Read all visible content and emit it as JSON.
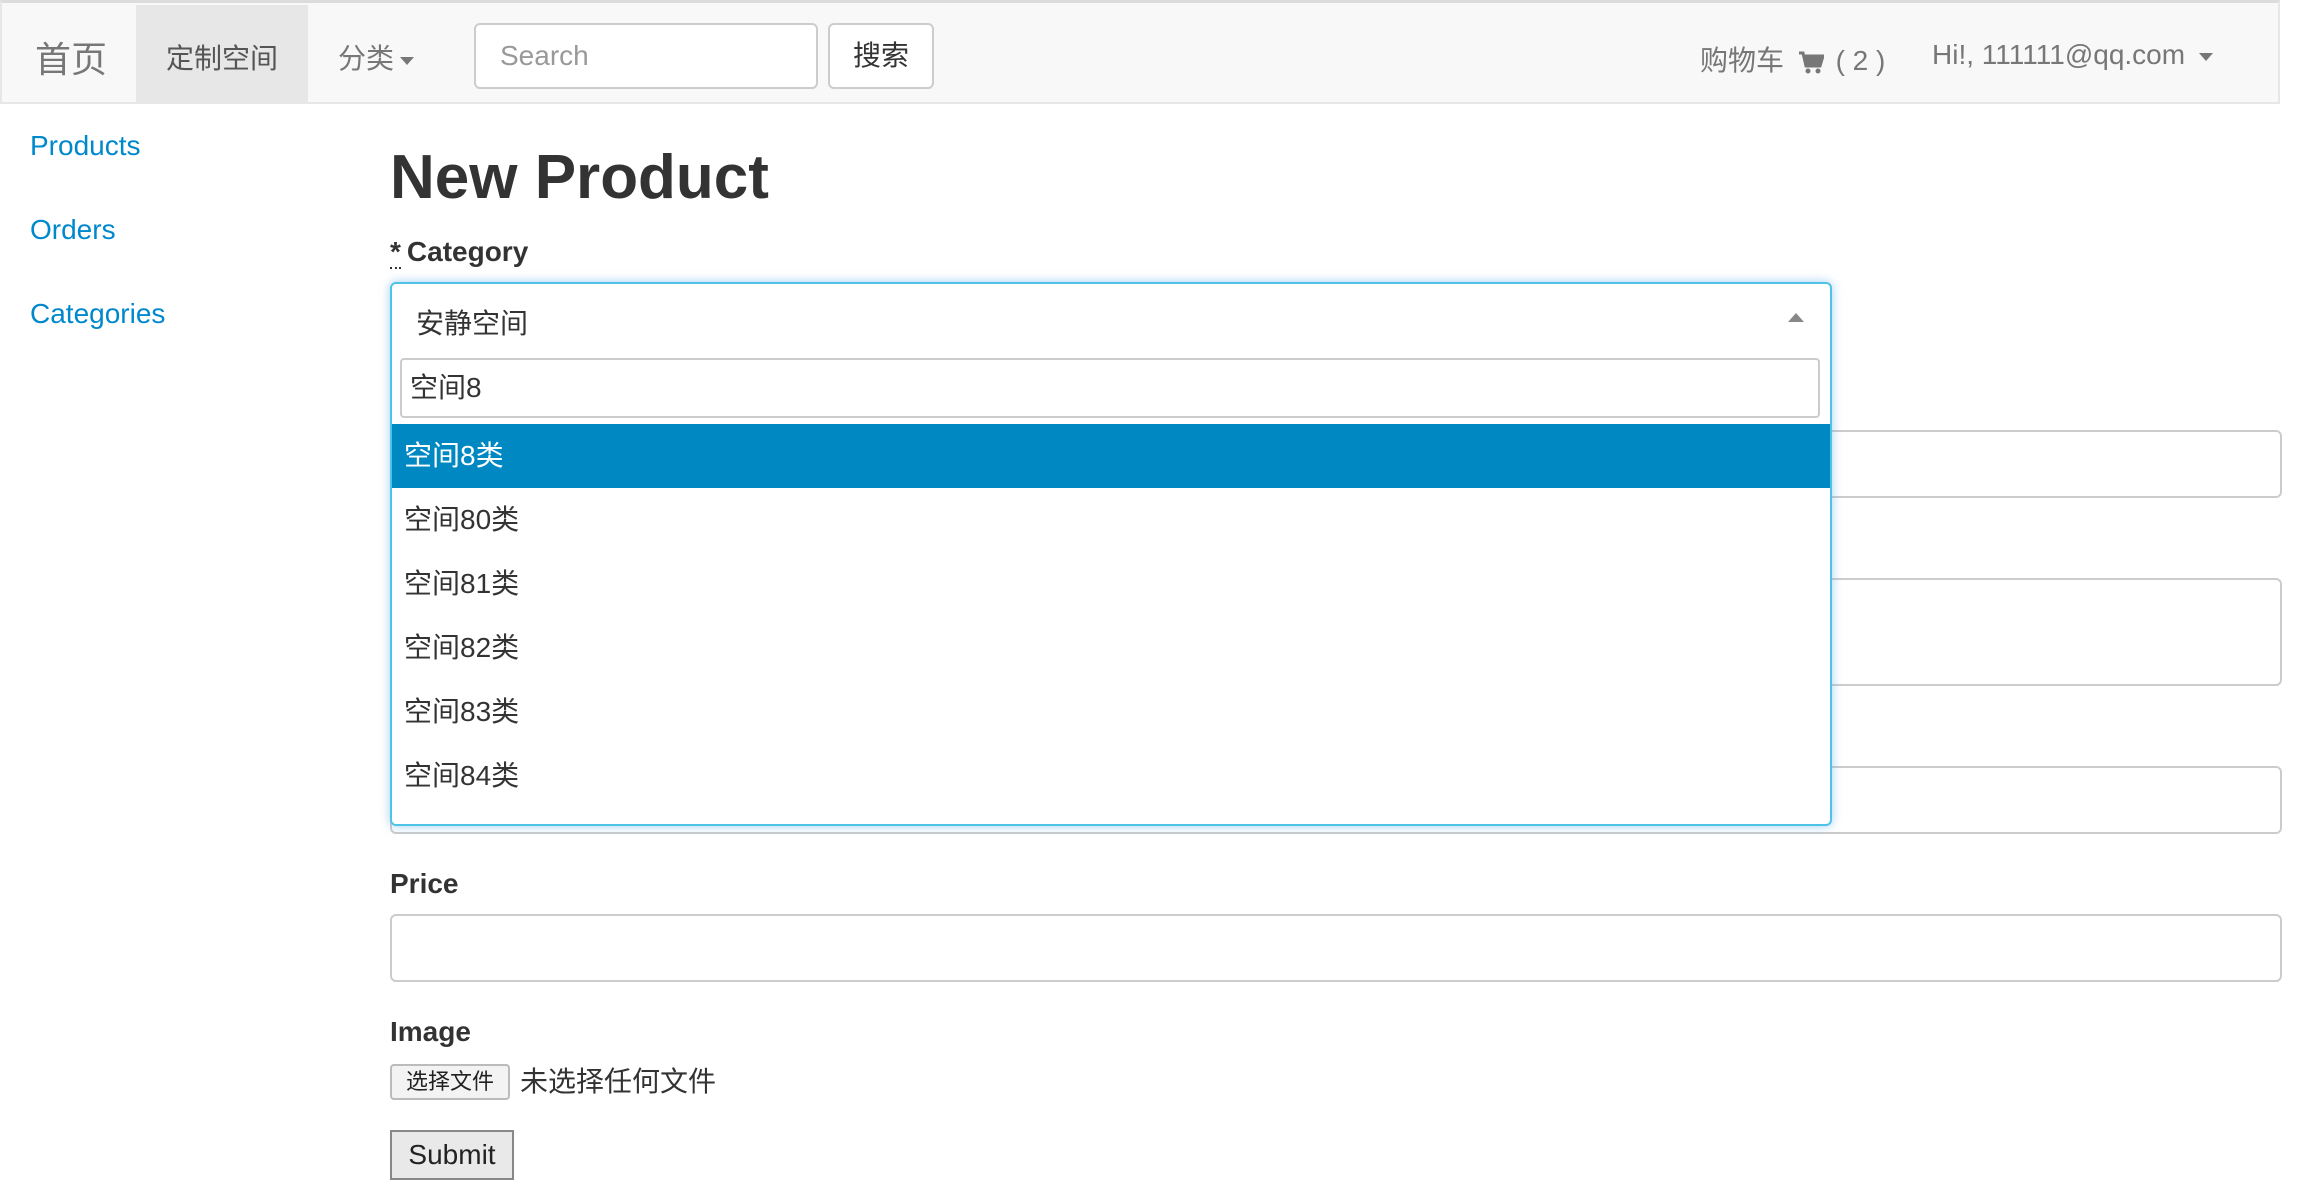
{
  "navbar": {
    "brand": "首页",
    "active_item": "定制空间",
    "category_menu": "分类",
    "search": {
      "placeholder": "Search",
      "button": "搜索"
    },
    "cart": {
      "label": "购物车",
      "count": "( 2 )"
    },
    "user": "Hi!, 111111@qq.com"
  },
  "sidebar": {
    "items": [
      {
        "label": "Products"
      },
      {
        "label": "Orders"
      },
      {
        "label": "Categories"
      }
    ]
  },
  "main": {
    "title": "New Product",
    "category": {
      "required_mark": "*",
      "label": "Category",
      "selected": "安静空间",
      "search_value": "空间8",
      "options": [
        "空间8类",
        "空间80类",
        "空间81类",
        "空间82类",
        "空间83类",
        "空间84类"
      ],
      "highlighted_index": 0
    },
    "price_label": "Price",
    "image_label": "Image",
    "file_button": "选择文件",
    "file_status": "未选择任何文件",
    "submit": "Submit"
  },
  "colors": {
    "link": "#0088cc",
    "highlight": "#0088c2",
    "focus_border": "#4fc3e7"
  }
}
